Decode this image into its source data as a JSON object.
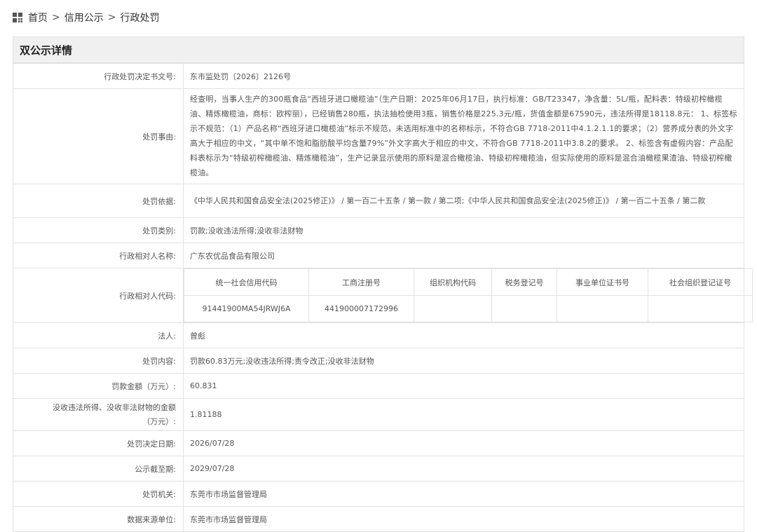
{
  "breadcrumb": {
    "items": [
      "首页",
      "信用公示",
      "行政处罚"
    ],
    "separator": ">"
  },
  "panel": {
    "title": "双公示详情"
  },
  "rows": {
    "decision_no": {
      "label": "行政处罚决定书文号:",
      "value": "东市监处罚〔2026〕2126号"
    },
    "reason": {
      "label": "处罚事由:",
      "value": "经查明，当事人生产的300瓶食品“西班牙进口橄榄油”（生产日期：2025年06月17日，执行标准：GB/T23347，净含量：5L/瓶，配料表：特级初榨橄榄油、精炼橄榄油，商标：欧榨丽），已经销售280瓶，执法抽检使用3瓶，销售价格是225.3元/瓶，货值金额是67590元，违法所得是18118.8元： 1、标签标示不规范：（1）产品名称“西班牙进口橄榄油”标示不规范，未选用标准中的名称标示，不符合GB 7718-2011中4.1.2.1.1的要求；（2）营养成分表的外文字高大于相应的中文，“其中单不饱和脂肪酸平均含量79%”外文字高大于相应的中文，不符合GB 7718-2011中3.8.2的要求。 2、标签含有虚假内容：产品配料表标示为“特级初榨橄榄油、精炼橄榄油”，生产记录显示使用的原料是混合橄榄油、特级初榨橄榄油，但实际使用的原料是混合油橄榄果渣油、特级初榨橄榄油。"
    },
    "basis": {
      "label": "处罚依据:",
      "value": "《中华人民共和国食品安全法(2025修正)》 / 第一百二十五条 / 第一款 / 第二项;《中华人民共和国食品安全法(2025修正)》 / 第一百二十五条 / 第二款"
    },
    "category": {
      "label": "处罚类别:",
      "value": "罚款;没收违法所得;没收非法财物"
    },
    "counterpart_name": {
      "label": "行政相对人名称:",
      "value": "广东农优品食品有限公司"
    },
    "counterpart_code": {
      "label": "行政相对人代码:",
      "headers": [
        "统一社会信用代码",
        "工商注册号",
        "组织机构代码",
        "税务登记号",
        "事业单位证书号",
        "社会组织登记证号"
      ],
      "values": [
        "91441900MA54JRWJ6A",
        "441900007172996",
        "",
        "",
        "",
        ""
      ]
    },
    "legal_person": {
      "label": "法人:",
      "value": "曾彪"
    },
    "content": {
      "label": "处罚内容:",
      "value": "罚款60.83万元;没收违法所得;责令改正;没收非法财物"
    },
    "fine": {
      "label": "罚款金额（万元）:",
      "value": "60.831"
    },
    "confiscation": {
      "label": "没收违法所得、没收非法财物的金额（万元）:",
      "value": "1.81188"
    },
    "decision_date": {
      "label": "处罚决定日期:",
      "value": "2026/07/28"
    },
    "deadline": {
      "label": "公示截至期:",
      "value": "2029/07/28"
    },
    "authority": {
      "label": "处罚机关:",
      "value": "东莞市市场监督管理局"
    },
    "source": {
      "label": "数据来源单位:",
      "value": "东莞市市场监督管理局"
    }
  }
}
